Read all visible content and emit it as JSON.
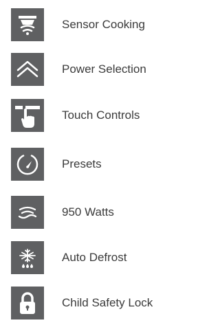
{
  "features": [
    {
      "icon": "sensor-cooking-icon",
      "label": "Sensor Cooking"
    },
    {
      "icon": "power-selection-icon",
      "label": "Power Selection"
    },
    {
      "icon": "touch-controls-icon",
      "label": "Touch Controls"
    },
    {
      "icon": "presets-icon",
      "label": "Presets"
    },
    {
      "icon": "watts-icon",
      "label": "950 Watts"
    },
    {
      "icon": "auto-defrost-icon",
      "label": "Auto Defrost"
    },
    {
      "icon": "child-safety-lock-icon",
      "label": "Child Safety Lock"
    }
  ],
  "colors": {
    "icon_tile": "#5f6062",
    "icon_fg": "#ffffff",
    "text": "#3a3a3a"
  }
}
